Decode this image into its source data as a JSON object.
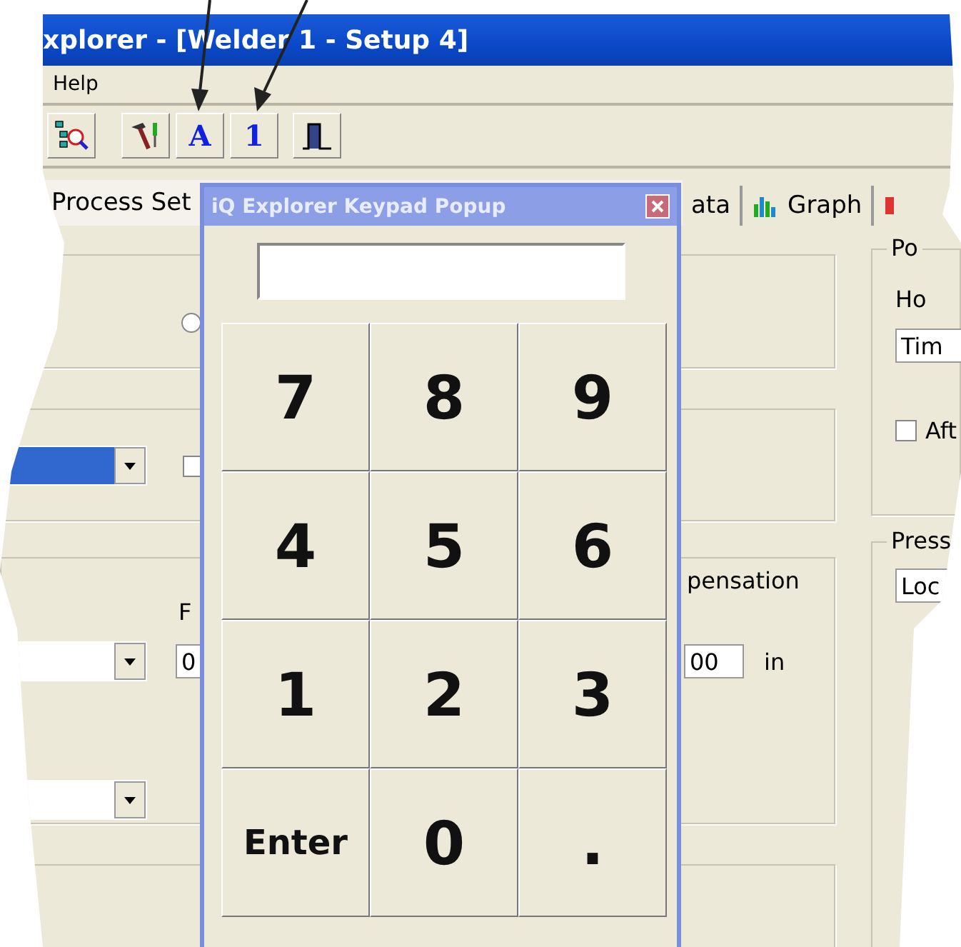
{
  "window": {
    "title": "xplorer - [Welder 1 - Setup 4]"
  },
  "menu": [
    {
      "label": "Help"
    }
  ],
  "toolbar": [
    {
      "kind": "tree"
    },
    {
      "kind": "tools"
    },
    {
      "kind": "letter",
      "label": "A"
    },
    {
      "kind": "letter",
      "label": "1"
    },
    {
      "kind": "pulse"
    }
  ],
  "tabs": [
    {
      "label": "Process Set",
      "selected": true
    },
    {
      "label": "ata",
      "selected": false
    },
    {
      "label": "Graph",
      "selected": false
    }
  ],
  "form": {
    "radio": {
      "selected": false
    },
    "dropdown_1": {
      "focused": true
    },
    "checkbox_1": {
      "checked": false
    },
    "label_1": "pensation",
    "label_2": "F",
    "field_1": "0",
    "field_2": "00",
    "unit": "in"
  },
  "right_panel": {
    "group_1_title": "Po",
    "label": "Ho",
    "field_1": "Tim",
    "checkbox": {
      "label": "Aft",
      "checked": false
    },
    "group_2_title": "Press",
    "field_2": "Loc"
  },
  "popup": {
    "title": "iQ Explorer Keypad Popup",
    "keys": [
      {
        "label": "7",
        "kind": "digit"
      },
      {
        "label": "8",
        "kind": "digit"
      },
      {
        "label": "9",
        "kind": "digit"
      },
      {
        "label": "4",
        "kind": "digit"
      },
      {
        "label": "5",
        "kind": "digit"
      },
      {
        "label": "6",
        "kind": "digit"
      },
      {
        "label": "1",
        "kind": "digit"
      },
      {
        "label": "2",
        "kind": "digit"
      },
      {
        "label": "3",
        "kind": "digit"
      },
      {
        "label": "Enter",
        "kind": "word"
      },
      {
        "label": "0",
        "kind": "digit"
      },
      {
        "label": ".",
        "kind": "digit"
      }
    ]
  }
}
